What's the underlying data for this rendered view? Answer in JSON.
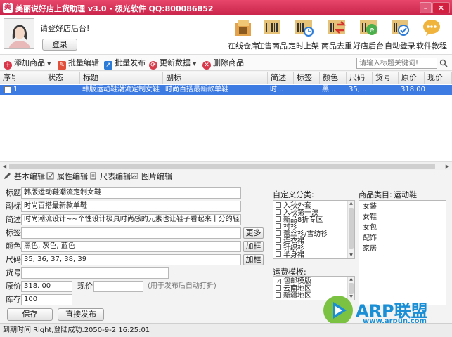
{
  "window": {
    "title": "美丽说好店上货助理 v3.0 - 极光软件 QQ:800086852",
    "min": "–",
    "close": "✕"
  },
  "account": {
    "greeting": "请登好店后台!",
    "login_label": "登录"
  },
  "tools": [
    {
      "label": "在线仓库",
      "icon": "warehouse-icon"
    },
    {
      "label": "在售商品",
      "icon": "barcode-icon"
    },
    {
      "label": "定时上架",
      "icon": "clock-icon"
    },
    {
      "label": "商品去重",
      "icon": "dedupe-icon"
    },
    {
      "label": "好店后台",
      "icon": "browser-icon"
    },
    {
      "label": "自动登录",
      "icon": "auto-login-icon"
    },
    {
      "label": "软件教程",
      "icon": "tutorial-icon"
    }
  ],
  "toolbar": {
    "add": "添加商品",
    "batch_edit": "批量编辑",
    "batch_publish": "批量发布",
    "update": "更新数据",
    "delete": "删除商品",
    "search_placeholder": "请输入标题关键词!"
  },
  "grid": {
    "columns": [
      "序号",
      "状态",
      "标题",
      "副标",
      "简述",
      "标签",
      "颜色",
      "尺码",
      "货号",
      "原价",
      "现价"
    ],
    "rows": [
      {
        "index": "1",
        "status": "",
        "title": "韩版运动鞋潮流定制女鞋",
        "subtitle": "时尚百搭最新款单鞋",
        "brief": "时...",
        "tag": "",
        "color": "黑...",
        "size": "35,...",
        "sku": "",
        "price": "318.00",
        "now": ""
      }
    ]
  },
  "edit_tabs": [
    "基本编辑",
    "属性编辑",
    "尺表编辑",
    "图片编辑"
  ],
  "form": {
    "title_label": "标题",
    "title_value": "韩版运动鞋潮流定制女鞋",
    "subtitle_label": "副标",
    "subtitle_value": "时尚百搭最新款单鞋",
    "brief_label": "简述",
    "brief_value": "时尚潮流设计~~个性设计极具时尚感的元素也让鞋子看起来十分的轻盈~~大牌范",
    "tag_label": "标签",
    "tag_value": "",
    "more_label": "更多",
    "color_label": "颜色",
    "color_value": "黑色, 灰色, 蓝色",
    "add_color_label": "加框",
    "size_label": "尺码",
    "size_value": "35, 36, 37, 38, 39",
    "add_size_label": "加框",
    "sku_label": "货号",
    "sku_value": "",
    "price_label": "原价",
    "price_value": "318. 00",
    "now_label": "现价",
    "now_value": "",
    "now_hint": "(用于发布后自动打折)",
    "stock_label": "库存",
    "stock_value": "100",
    "save_label": "保存",
    "publish_label": "直接发布"
  },
  "custom_category": {
    "label": "自定义分类:",
    "items": [
      "入秋外套",
      "入秋第一波",
      "新品8折专区",
      "衬衫",
      "蕾丝衫/雪纺衫",
      "连衣裙",
      "针织衫",
      "半身裙"
    ]
  },
  "shipping": {
    "label": "运费模板:",
    "items": [
      {
        "label": "包邮模版",
        "checked": true
      },
      {
        "label": "云南地区",
        "checked": false
      },
      {
        "label": "新疆地区",
        "checked": false
      }
    ]
  },
  "product_category": {
    "label": "商品类目:",
    "value": "运动鞋",
    "items": [
      "女装",
      "女鞋",
      "女包",
      "配饰",
      "家居"
    ]
  },
  "logo": {
    "brand": "ARP联盟",
    "url": "www.arpun.com"
  },
  "status": {
    "expiry_label": "到期时间",
    "message": "Right,登陆成功.2050-9-2 16:25:01"
  },
  "colors": {
    "titlebar": "#d22a52",
    "selection": "#3d7be3",
    "logo": "#1a8fd6"
  }
}
